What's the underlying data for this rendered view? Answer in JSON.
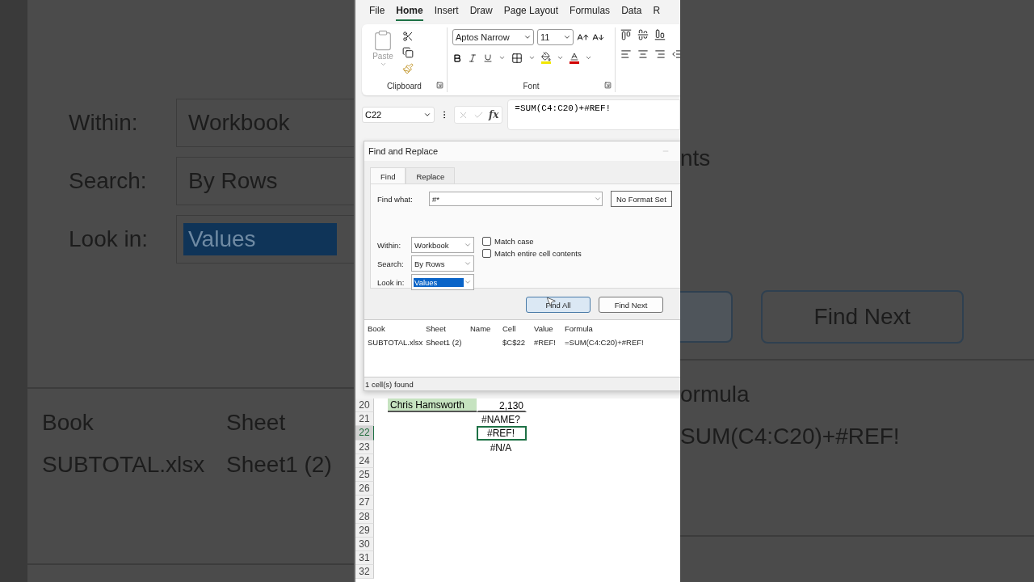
{
  "zoomed_background": {
    "left": {
      "fields": [
        {
          "label": "Within:",
          "value": "Workbook",
          "selected": false
        },
        {
          "label": "Search:",
          "value": "By Rows",
          "selected": false
        },
        {
          "label": "Look in:",
          "value": "Values",
          "selected": true
        }
      ],
      "columns": [
        "Book",
        "Sheet"
      ],
      "row": [
        "SUBTOTAL.xlsx",
        "Sheet1 (2)"
      ]
    },
    "right": {
      "option_fragment": "nts",
      "button": "Find Next",
      "column_fragment": "ormula",
      "cell_fragment": "SUM(C4:C20)+#REF!"
    }
  },
  "excel": {
    "ribbon_tabs": [
      {
        "label": "File",
        "selected": false
      },
      {
        "label": "Home",
        "selected": true
      },
      {
        "label": "Insert",
        "selected": false
      },
      {
        "label": "Draw",
        "selected": false
      },
      {
        "label": "Page Layout",
        "selected": false
      },
      {
        "label": "Formulas",
        "selected": false
      },
      {
        "label": "Data",
        "selected": false
      },
      {
        "label": "R",
        "selected": false
      }
    ],
    "clipboard": {
      "paste": "Paste",
      "group": "Clipboard"
    },
    "font": {
      "name": "Aptos Narrow",
      "size": "11",
      "group": "Font"
    },
    "formula_bar": {
      "name_box": "C22",
      "fx": "fx",
      "formula": "=SUM(C4:C20)+#REF!"
    },
    "dialog": {
      "title": "Find and Replace",
      "tabs": [
        {
          "label": "Find",
          "selected": true
        },
        {
          "label": "Replace",
          "selected": false
        }
      ],
      "find_what": {
        "label": "Find what:",
        "value": "#*"
      },
      "format_button": "No Format Set",
      "options": [
        {
          "label": "Within:",
          "value": "Workbook",
          "selected": false
        },
        {
          "label": "Search:",
          "value": "By Rows",
          "selected": false
        },
        {
          "label": "Look in:",
          "value": "Values",
          "selected": true
        }
      ],
      "checkboxes": [
        {
          "label": "Match case",
          "checked": false
        },
        {
          "label": "Match entire cell contents",
          "checked": false
        }
      ],
      "buttons": [
        {
          "label": "Find All",
          "focused": true
        },
        {
          "label": "Find Next",
          "focused": false
        }
      ],
      "results": {
        "columns": [
          "Book",
          "Sheet",
          "Name",
          "Cell",
          "Value",
          "Formula"
        ],
        "rows": [
          [
            "SUBTOTAL.xlsx",
            "Sheet1 (2)",
            "",
            "$C$22",
            "#REF!",
            "=SUM(C4:C20)+#REF!"
          ]
        ]
      },
      "status": "1 cell(s) found"
    },
    "sheet": {
      "rows": [
        {
          "number": "20",
          "selected": false,
          "name": "Chris Hamsworth",
          "highlighted": true,
          "value": "2,130"
        },
        {
          "number": "21",
          "selected": false,
          "value": "#NAME?"
        },
        {
          "number": "22",
          "selected": true,
          "value": "#REF!"
        },
        {
          "number": "23",
          "selected": false,
          "value": "#N/A"
        },
        {
          "number": "24",
          "selected": false
        },
        {
          "number": "25",
          "selected": false
        },
        {
          "number": "26",
          "selected": false
        },
        {
          "number": "27",
          "selected": false
        },
        {
          "number": "28",
          "selected": false
        },
        {
          "number": "29",
          "selected": false
        },
        {
          "number": "30",
          "selected": false
        },
        {
          "number": "31",
          "selected": false
        },
        {
          "number": "32",
          "selected": false
        }
      ]
    }
  }
}
